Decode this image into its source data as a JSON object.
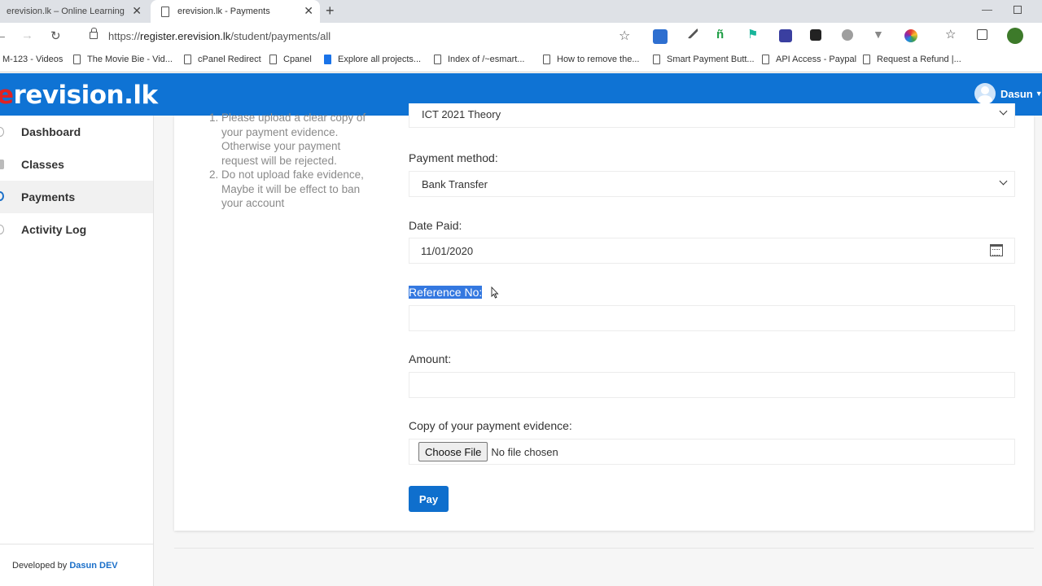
{
  "browser": {
    "tabs": [
      {
        "title": "erevision.lk – Online Learning Ma",
        "active": false
      },
      {
        "title": "erevision.lk - Payments",
        "active": true
      }
    ],
    "url": {
      "scheme": "https://",
      "host": "register.erevision.lk",
      "path": "/student/payments/all"
    },
    "extensions": [
      "new-badge-ext-icon",
      "eyedropper-ext-icon",
      "fi-ext-icon",
      "flag-ext-icon",
      "screen-ext-icon",
      "cube-ext-icon",
      "circle-ext-icon",
      "vee-ext-icon",
      "colorwheel-ext-icon",
      "favorites-icon",
      "collections-icon",
      "profile-avatar-icon"
    ],
    "bookmarks": [
      {
        "label": "M-123 - Videos"
      },
      {
        "label": "The Movie Bie - Vid..."
      },
      {
        "label": "cPanel Redirect"
      },
      {
        "label": "Cpanel"
      },
      {
        "label": "Explore all projects..."
      },
      {
        "label": "Index of /~esmart..."
      },
      {
        "label": "How to remove the..."
      },
      {
        "label": "Smart Payment Butt..."
      },
      {
        "label": "API Access - Paypal"
      },
      {
        "label": "Request a Refund |..."
      }
    ]
  },
  "header": {
    "brand_first": "e",
    "brand_rest": "revision.lk",
    "user_name": "Dasun"
  },
  "sidebar": {
    "items": [
      {
        "label": "Dashboard",
        "active": false
      },
      {
        "label": "Classes",
        "active": false
      },
      {
        "label": "Payments",
        "active": true
      },
      {
        "label": "Activity Log",
        "active": false
      }
    ],
    "footer_prefix": "Developed by",
    "footer_link": "Dasun DEV"
  },
  "notes": {
    "items": [
      "Please upload a clear copy of your payment evidence. Otherwise your payment request will be rejected.",
      "Do not upload fake evidence, Maybe it will be effect to ban your account"
    ]
  },
  "form": {
    "class_value": "ICT 2021 Theory",
    "payment_method_label": "Payment method:",
    "payment_method_value": "Bank Transfer",
    "date_label": "Date Paid:",
    "date_value": "11/01/2020",
    "reference_label": "Reference No:",
    "reference_value": "",
    "amount_label": "Amount:",
    "amount_value": "",
    "evidence_label": "Copy of your payment evidence:",
    "choose_file_label": "Choose File",
    "file_status": "No file chosen",
    "pay_label": "Pay"
  },
  "colors": {
    "appbar": "#0f73d4",
    "brand_accent": "#e02222",
    "selection": "#3478e0",
    "pay_button": "#0f6fcd"
  }
}
